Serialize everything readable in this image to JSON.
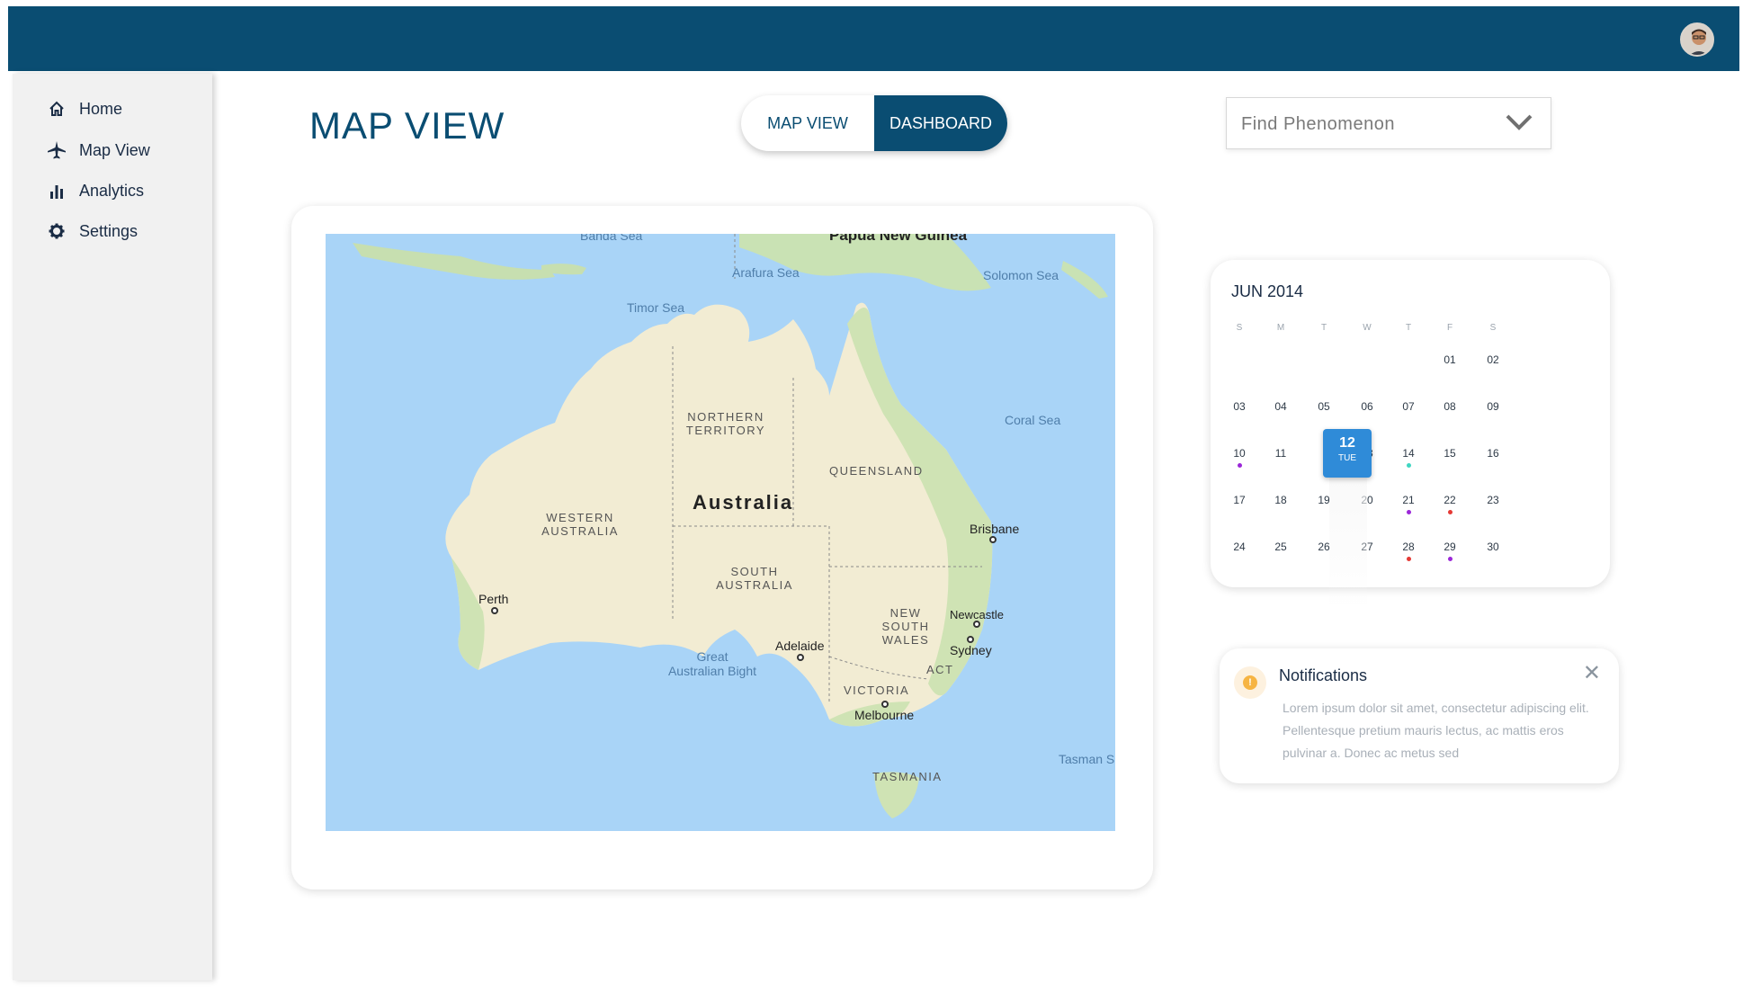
{
  "header": {
    "avatar_icon": "user-avatar"
  },
  "sidebar": {
    "items": [
      {
        "label": "Home",
        "icon": "home-icon"
      },
      {
        "label": "Map View",
        "icon": "airplane-icon"
      },
      {
        "label": "Analytics",
        "icon": "bar-chart-icon"
      },
      {
        "label": "Settings",
        "icon": "gear-icon"
      }
    ]
  },
  "main": {
    "title": "MAP VIEW",
    "toggle": {
      "left": "MAP VIEW",
      "right": "DASHBOARD"
    },
    "dropdown": {
      "placeholder": "Find Phenomenon"
    }
  },
  "map": {
    "country": "Australia",
    "regions": [
      "NORTHERN TERRITORY",
      "QUEENSLAND",
      "WESTERN AUSTRALIA",
      "SOUTH AUSTRALIA",
      "NEW SOUTH WALES",
      "VICTORIA",
      "TASMANIA",
      "ACT"
    ],
    "seas": [
      "Arafura Sea",
      "Timor Sea",
      "Solomon Sea",
      "Coral Sea",
      "Great Australian Bight",
      "Tasman S",
      "Banda Sea"
    ],
    "cities": [
      "Perth",
      "Adelaide",
      "Melbourne",
      "Sydney",
      "Newcastle",
      "Brisbane"
    ],
    "png": "Papua New Guinea"
  },
  "calendar": {
    "title": "JUN 2014",
    "weekdays": [
      "S",
      "M",
      "T",
      "W",
      "T",
      "F",
      "S"
    ],
    "days": [
      "01",
      "02",
      "03",
      "04",
      "05",
      "06",
      "07",
      "08",
      "09",
      "10",
      "11",
      "12",
      "13",
      "14",
      "15",
      "16",
      "17",
      "18",
      "19",
      "20",
      "21",
      "22",
      "23",
      "24",
      "25",
      "26",
      "27",
      "28",
      "29",
      "30"
    ],
    "selected": {
      "day": "12",
      "weekday": "TUE"
    },
    "colors": {
      "purple": "#9b27d8",
      "orange": "#f5a623",
      "teal": "#3fd6c2",
      "red": "#e53935",
      "accent": "#2f8bd8"
    }
  },
  "notifications": {
    "title": "Notifications",
    "body": "Lorem ipsum dolor sit amet, consectetur adipiscing elit. Pellentesque pretium mauris lectus, ac mattis eros pulvinar a. Donec ac metus sed"
  }
}
